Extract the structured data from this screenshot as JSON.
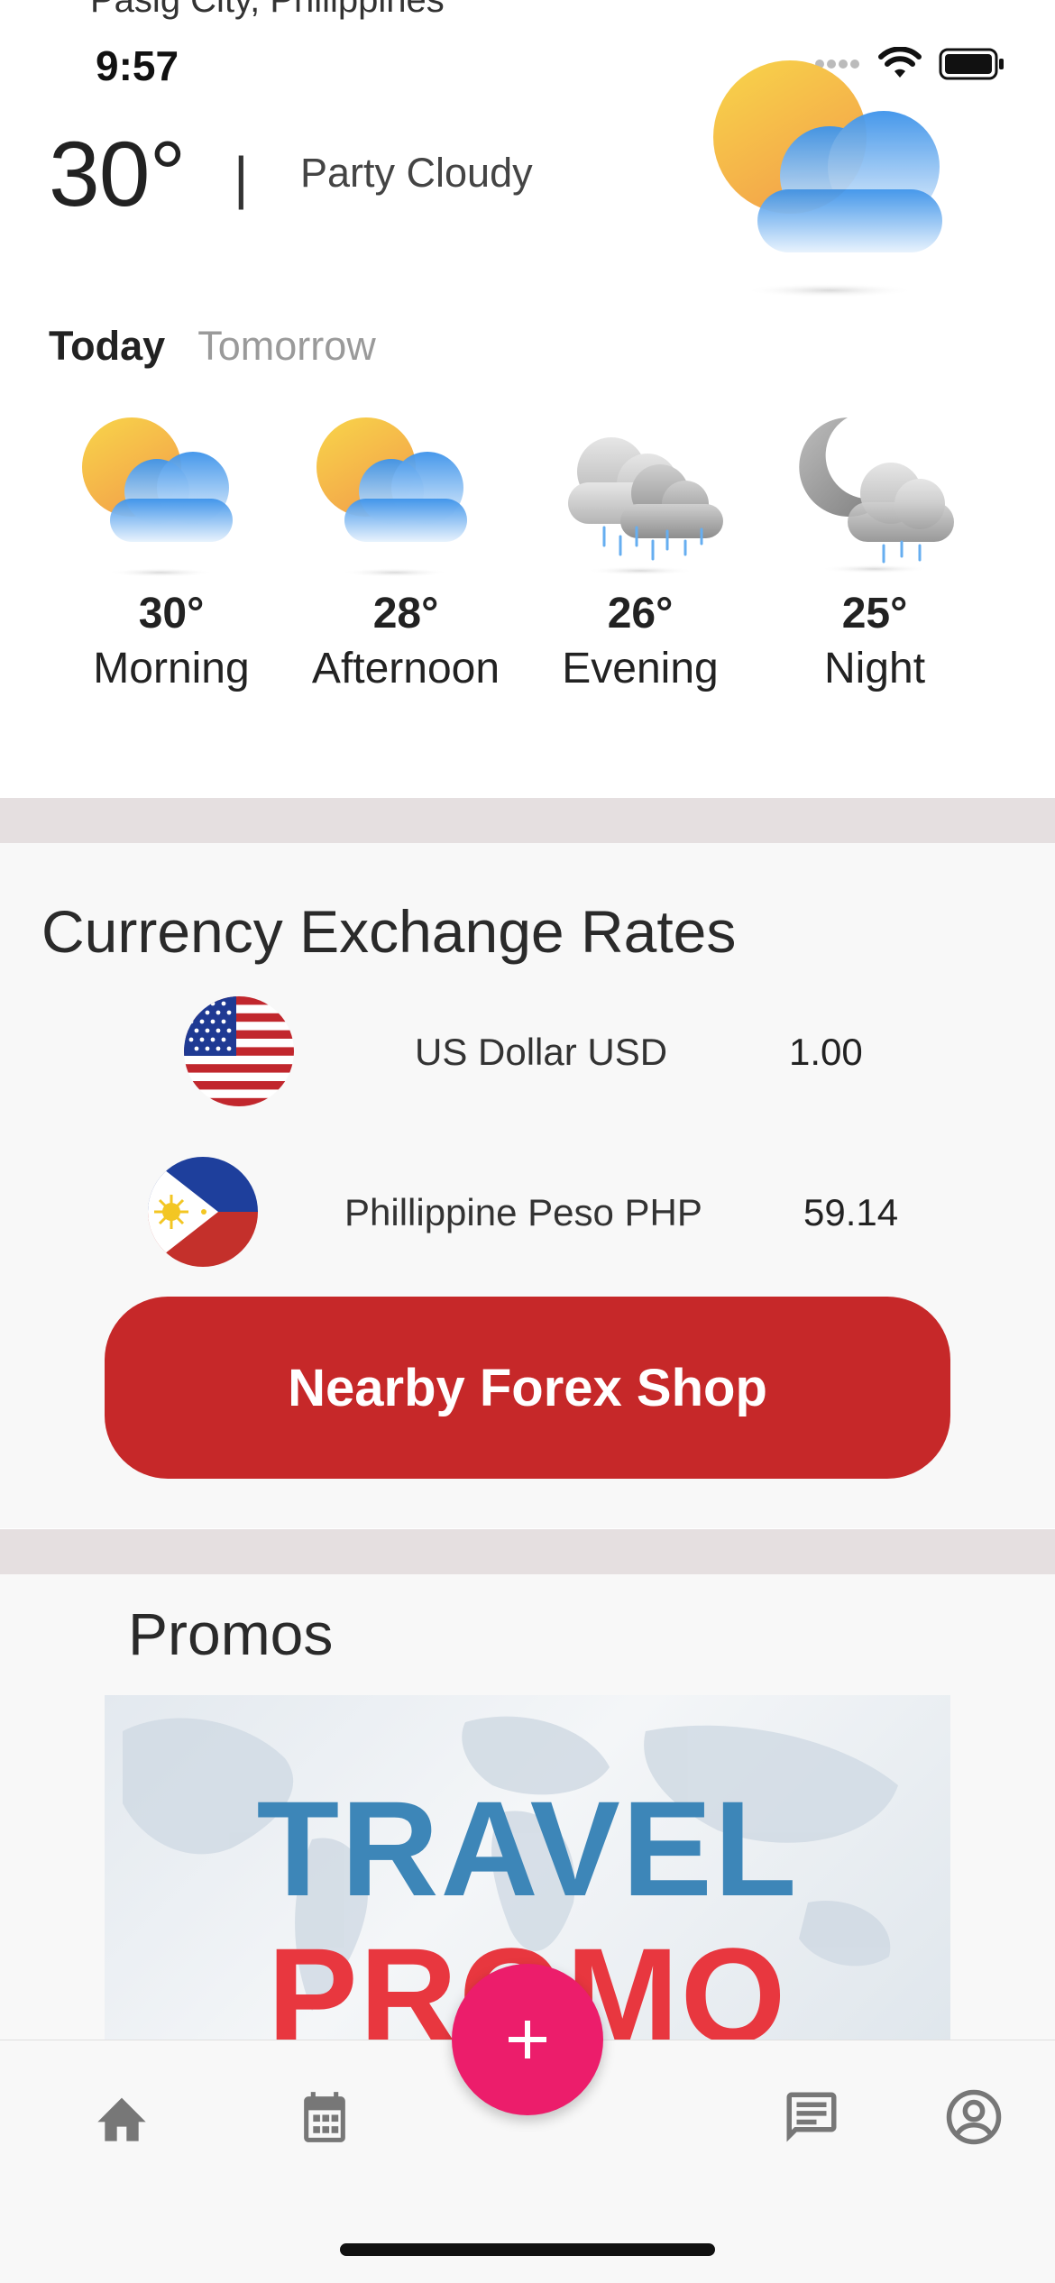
{
  "status_bar": {
    "location": "Pasig City, Philippines",
    "time": "9:57"
  },
  "weather": {
    "current_temp": "30°",
    "separator": "|",
    "condition": "Party Cloudy",
    "hero_icon": "partly-cloudy-icon",
    "tabs": [
      {
        "label": "Today",
        "active": true
      },
      {
        "label": "Tomorrow",
        "active": false
      }
    ],
    "periods": [
      {
        "temp": "30°",
        "label": "Morning",
        "icon": "partly-cloudy-icon"
      },
      {
        "temp": "28°",
        "label": "Afternoon",
        "icon": "partly-cloudy-icon"
      },
      {
        "temp": "26°",
        "label": "Evening",
        "icon": "rain-cloud-icon"
      },
      {
        "temp": "25°",
        "label": "Night",
        "icon": "night-rain-icon"
      }
    ]
  },
  "currency": {
    "title": "Currency Exchange Rates",
    "rates": [
      {
        "name": "US Dollar USD",
        "value": "1.00",
        "flag": "us-flag-icon"
      },
      {
        "name": "Phillippine Peso PHP",
        "value": "59.14",
        "flag": "ph-flag-icon"
      }
    ],
    "button_label": "Nearby Forex Shop"
  },
  "promos": {
    "title": "Promos",
    "banner_line1": "TRAVEL",
    "banner_line2": "PROMO"
  },
  "nav": {
    "items": [
      "home-icon",
      "calendar-icon",
      "add-icon",
      "chat-icon",
      "account-icon"
    ]
  },
  "colors": {
    "accent_red": "#c62829",
    "fab_pink": "#ec1d6b",
    "divider": "#e5dfe0",
    "promo_blue": "#3d86b8",
    "promo_red": "#e8373f"
  }
}
